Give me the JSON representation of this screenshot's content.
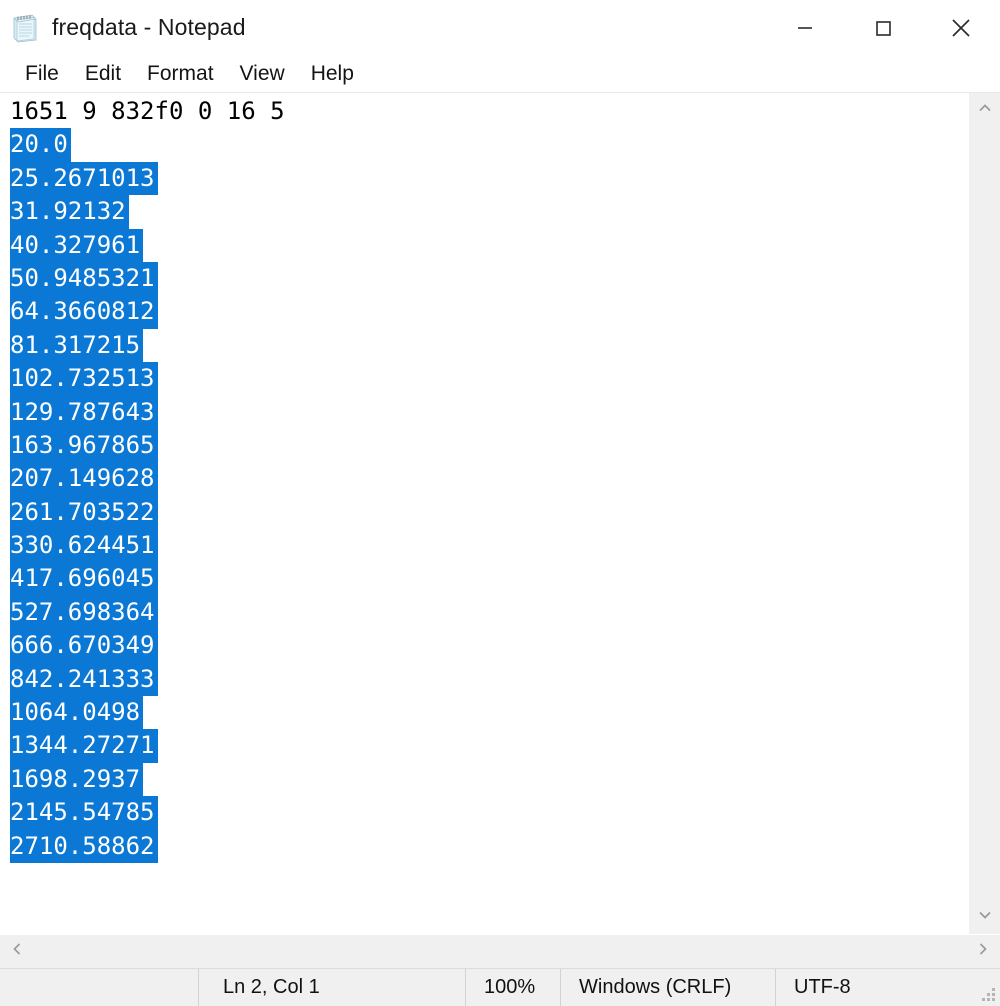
{
  "window": {
    "title": "freqdata - Notepad",
    "app_icon": "notepad-icon",
    "controls": {
      "minimize": "minimize-icon",
      "maximize": "maximize-icon",
      "close": "close-icon"
    }
  },
  "menubar": {
    "items": [
      {
        "label": "File"
      },
      {
        "label": "Edit"
      },
      {
        "label": "Format"
      },
      {
        "label": "View"
      },
      {
        "label": "Help"
      }
    ]
  },
  "editor": {
    "selection_color": "#0a78d4",
    "selection_text_color": "#ffffff",
    "text_color": "#000000",
    "background_color": "#ffffff",
    "lines": [
      {
        "text": "1651 9 832f0 0 16 5",
        "selected": false
      },
      {
        "text": "20.0",
        "selected": true
      },
      {
        "text": "25.2671013",
        "selected": true
      },
      {
        "text": "31.92132",
        "selected": true
      },
      {
        "text": "40.327961",
        "selected": true
      },
      {
        "text": "50.9485321",
        "selected": true
      },
      {
        "text": "64.3660812",
        "selected": true
      },
      {
        "text": "81.317215",
        "selected": true
      },
      {
        "text": "102.732513",
        "selected": true
      },
      {
        "text": "129.787643",
        "selected": true
      },
      {
        "text": "163.967865",
        "selected": true
      },
      {
        "text": "207.149628",
        "selected": true
      },
      {
        "text": "261.703522",
        "selected": true
      },
      {
        "text": "330.624451",
        "selected": true
      },
      {
        "text": "417.696045",
        "selected": true
      },
      {
        "text": "527.698364",
        "selected": true
      },
      {
        "text": "666.670349",
        "selected": true
      },
      {
        "text": "842.241333",
        "selected": true
      },
      {
        "text": "1064.0498",
        "selected": true
      },
      {
        "text": "1344.27271",
        "selected": true
      },
      {
        "text": "1698.2937",
        "selected": true
      },
      {
        "text": "2145.54785",
        "selected": true
      },
      {
        "text": "2710.58862",
        "selected": true
      }
    ]
  },
  "scrollbars": {
    "vertical": {
      "up_arrow": "chevron-up-icon",
      "down_arrow": "chevron-down-icon"
    },
    "horizontal": {
      "left_arrow": "chevron-left-icon",
      "right_arrow": "chevron-right-icon"
    }
  },
  "statusbar": {
    "cursor_position": "Ln 2, Col 1",
    "zoom": "100%",
    "line_ending": "Windows (CRLF)",
    "encoding": "UTF-8"
  }
}
